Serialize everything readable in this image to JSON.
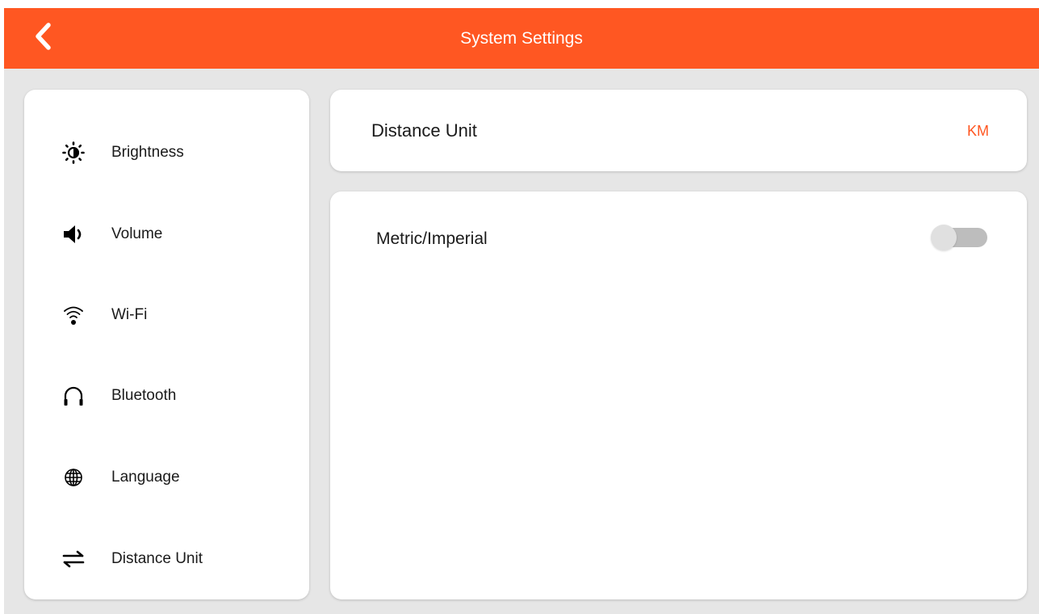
{
  "header": {
    "title": "System Settings",
    "back_icon": "chevron-left-icon",
    "background_color": "#ff5722"
  },
  "sidebar": {
    "items": [
      {
        "label": "Brightness",
        "icon": "brightness-icon"
      },
      {
        "label": "Volume",
        "icon": "volume-icon"
      },
      {
        "label": "Wi-Fi",
        "icon": "wifi-icon"
      },
      {
        "label": "Bluetooth",
        "icon": "headphones-icon"
      },
      {
        "label": "Language",
        "icon": "globe-icon"
      },
      {
        "label": "Distance Unit",
        "icon": "swap-arrows-icon"
      }
    ]
  },
  "distance_unit": {
    "label": "Distance Unit",
    "value": "KM",
    "value_color": "#ff5722"
  },
  "metric_imperial": {
    "label": "Metric/Imperial",
    "enabled": false
  }
}
